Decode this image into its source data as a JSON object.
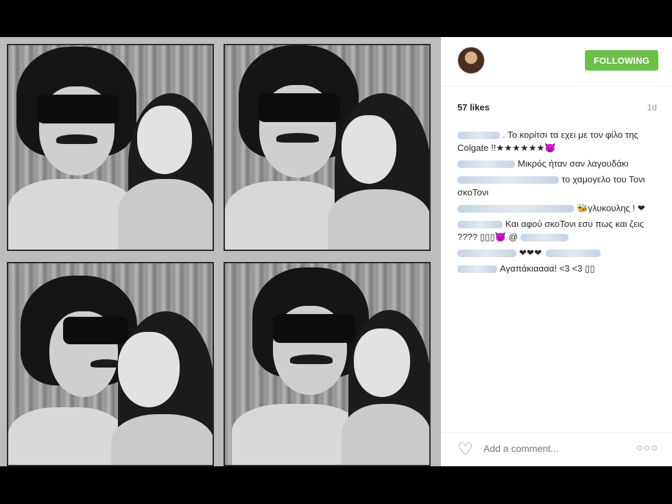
{
  "post": {
    "follow_label": "FOLLOWING",
    "likes": "57 likes",
    "age": "1d",
    "comments": [
      {
        "text": ". Το κορίτσι τα εχει με τον φίλο της Colgate !!★★★★★★😈"
      },
      {
        "text": "Μικρός ήταν σαν λαγουδάκι"
      },
      {
        "text": "το χαμογελο του Τονι σκοΤονι"
      },
      {
        "text": "🐝γλυκουλης ! ❤"
      },
      {
        "text": "Και αφού σκοΤονι εσυ πως και ζεις ???? ▯▯▯😈 @"
      },
      {
        "text": "❤❤❤"
      },
      {
        "text": "Αγαπάκιαααα! <3 <3 ▯▯"
      }
    ],
    "add_comment_placeholder": "Add a comment...",
    "more_label": "○○○"
  },
  "colors": {
    "follow_button": "#6cc04a",
    "background": "#000000"
  },
  "icons": {
    "heart": "heart-icon",
    "avatar": "profile-avatar",
    "more": "more-options-icon"
  }
}
